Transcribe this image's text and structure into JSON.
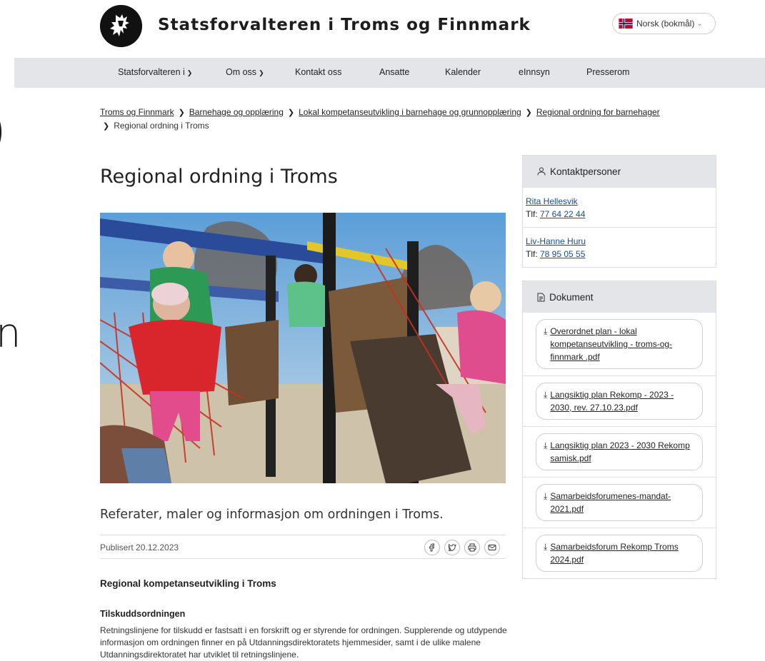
{
  "header": {
    "site_title": "Statsforvalteren i Troms og Finnmark",
    "language": "Norsk (bokmål)"
  },
  "nav": {
    "items": [
      {
        "label": "Statsforvalteren i",
        "has_dropdown": true
      },
      {
        "label": "Om oss",
        "has_dropdown": true
      },
      {
        "label": "Kontakt oss",
        "has_dropdown": false
      },
      {
        "label": "Ansatte",
        "has_dropdown": false
      },
      {
        "label": "Kalender",
        "has_dropdown": false
      },
      {
        "label": "eInnsyn",
        "has_dropdown": false
      },
      {
        "label": "Presserom",
        "has_dropdown": false
      }
    ]
  },
  "breadcrumb": {
    "items": [
      "Troms og Finnmark",
      "Barnehage og opplæring",
      "Lokal kompetanseutvikling i barnehage og grunnopplæring",
      "Regional ordning for barnehager"
    ],
    "current": "Regional ordning i Troms"
  },
  "article": {
    "title": "Regional ordning i Troms",
    "lead": "Referater, maler og informasjon om ordningen i Troms.",
    "published": "Publisert 20.12.2023",
    "section_heading": "Regional kompetanseutvikling i Troms",
    "sub_heading": "Tilskuddsordningen",
    "body": "Retningslinjene for tilskudd er fastsatt i en forskrift og er styrende for ordningen. Supplerende og utdypende informasjon om ordningen finner en på Utdanningsdirektoratets hjemmesider, samt i de ulike malene Utdanningsdirektoratet har utviklet til retningslinjene."
  },
  "contacts": {
    "heading": "Kontaktpersoner",
    "people": [
      {
        "name": "Rita Hellesvik",
        "phone_label": "Tlf: ",
        "phone": "77 64 22 44"
      },
      {
        "name": "Liv-Hanne Huru",
        "phone_label": "Tlf: ",
        "phone": "78 95 05 55"
      }
    ]
  },
  "documents": {
    "heading": "Dokument",
    "items": [
      "Overordnet plan - lokal kompetanseutvikling - troms-og-finnmark .pdf",
      "Langsiktig plan Rekomp - 2023 - 2030, rev. 27.10.23.pdf",
      "Langsiktig plan 2023 - 2030 Rekomp samisk.pdf",
      "Samarbeidsforumenes-mandat-2021.pdf",
      "Samarbeidsforum Rekomp Troms 2024.pdf"
    ]
  },
  "colors": {
    "nav_bg": "#e3e5e8",
    "link_blue": "#1a4d8c",
    "text": "#222222"
  },
  "icons": [
    "coat-of-arms-logo",
    "norway-flag-icon",
    "chevron-down-icon",
    "person-icon",
    "document-icon",
    "download-icon",
    "facebook-icon",
    "twitter-icon",
    "print-icon",
    "mail-icon"
  ]
}
